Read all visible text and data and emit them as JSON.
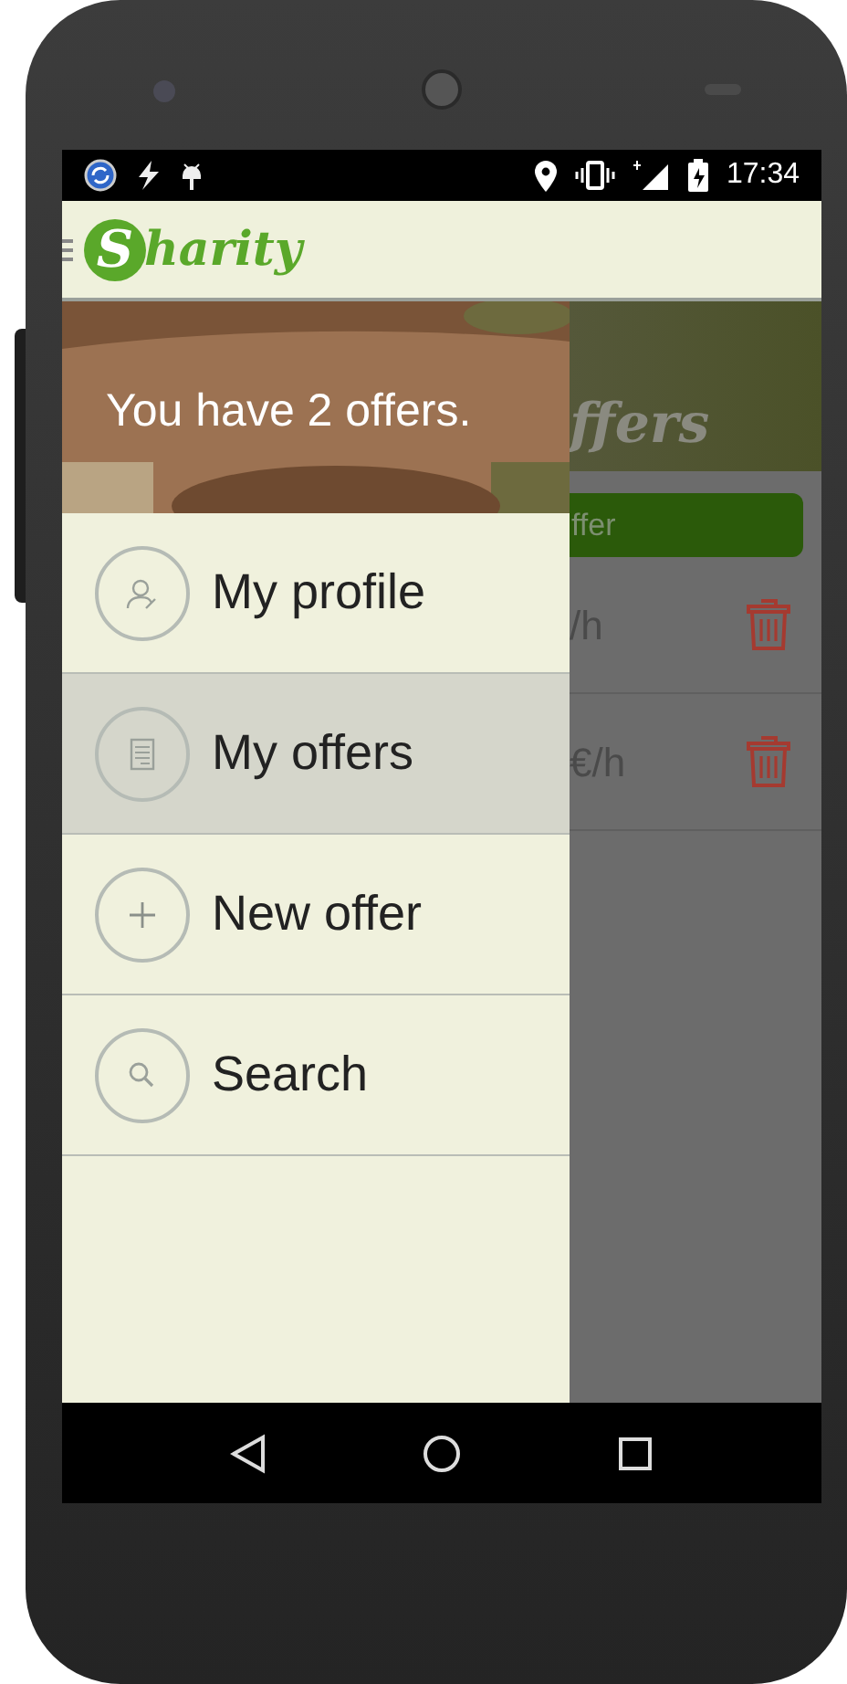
{
  "status_bar": {
    "time": "17:34"
  },
  "app_bar": {
    "logo_initial": "S",
    "logo_rest": "harity"
  },
  "drawer": {
    "header": {
      "kind": "picture",
      "text": "You have 2 offers."
    },
    "items": [
      {
        "label": "My profile",
        "kind": "profile",
        "selected": false
      },
      {
        "label": "My offers",
        "kind": "document",
        "selected": true
      },
      {
        "label": "New offer",
        "kind": "plus",
        "selected": false
      },
      {
        "label": "Search",
        "kind": "search",
        "selected": false
      }
    ]
  },
  "background": {
    "title_fragment": "ffers",
    "button_fragment": "ffer",
    "rows": [
      {
        "price_fragment": "/h"
      },
      {
        "price_fragment": "€/h"
      }
    ]
  }
}
